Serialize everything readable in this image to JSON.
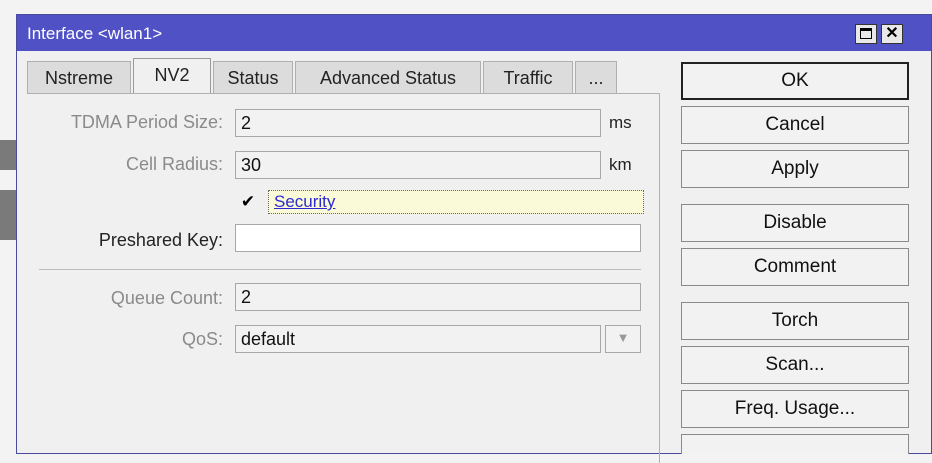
{
  "window": {
    "title": "Interface <wlan1>",
    "maximize_icon": "maximize-icon",
    "close_icon": "close-icon",
    "close_glyph": "✕"
  },
  "tabs": [
    {
      "label": "Nstreme"
    },
    {
      "label": "NV2",
      "active": true
    },
    {
      "label": "Status"
    },
    {
      "label": "Advanced Status"
    },
    {
      "label": "Traffic"
    },
    {
      "label": "..."
    }
  ],
  "form": {
    "tdma": {
      "label": "TDMA Period Size:",
      "value": "2",
      "unit": "ms"
    },
    "cell_radius": {
      "label": "Cell Radius:",
      "value": "30",
      "unit": "km"
    },
    "security": {
      "label": "Security",
      "checked": true,
      "check_glyph": "✔"
    },
    "preshared_key": {
      "label": "Preshared Key:",
      "value": ""
    },
    "queue_count": {
      "label": "Queue Count:",
      "value": "2"
    },
    "qos": {
      "label": "QoS:",
      "value": "default",
      "dropdown_glyph": "▼"
    }
  },
  "buttons": {
    "ok": "OK",
    "cancel": "Cancel",
    "apply": "Apply",
    "disable": "Disable",
    "comment": "Comment",
    "torch": "Torch",
    "scan": "Scan...",
    "freq_usage": "Freq. Usage..."
  },
  "colors": {
    "titlebar": "#5151c6",
    "link": "#2b2bd0"
  }
}
